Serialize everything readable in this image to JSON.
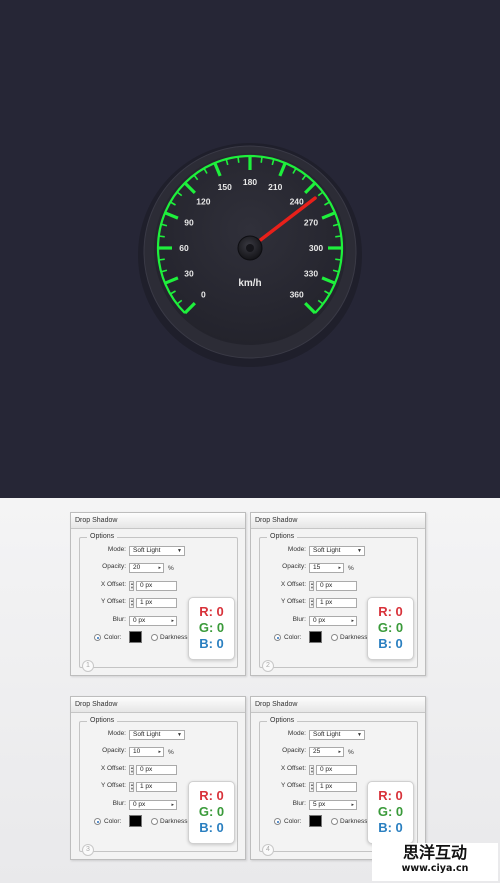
{
  "gauge": {
    "unit": "km/h",
    "min": 0,
    "max": 360,
    "scale_labels": [
      "0",
      "30",
      "60",
      "90",
      "120",
      "150",
      "180",
      "210",
      "240",
      "270",
      "300",
      "330",
      "360"
    ],
    "needle_value": 250,
    "colors": {
      "background": "#262636",
      "dial": "#2b2b33",
      "tick": "#1ef03c",
      "needle": "#e8201a",
      "label": "#e8e8e8"
    }
  },
  "panels": [
    {
      "title": "Drop Shadow",
      "legend": "Options",
      "mode_label": "Mode:",
      "mode": "Soft Light",
      "opacity_label": "Opacity:",
      "opacity": "20",
      "percent": "%",
      "xoffset_label": "X Offset:",
      "xoffset": "0 px",
      "yoffset_label": "Y Offset:",
      "yoffset": "1 px",
      "blur_label": "Blur:",
      "blur": "0 px",
      "color_label": "Color:",
      "darkness_label": "Darkness:",
      "number": "1"
    },
    {
      "title": "Drop Shadow",
      "legend": "Options",
      "mode_label": "Mode:",
      "mode": "Soft Light",
      "opacity_label": "Opacity:",
      "opacity": "15",
      "percent": "%",
      "xoffset_label": "X Offset:",
      "xoffset": "0 px",
      "yoffset_label": "Y Offset:",
      "yoffset": "1 px",
      "blur_label": "Blur:",
      "blur": "0 px",
      "color_label": "Color:",
      "darkness_label": "Darkness:",
      "number": "2"
    },
    {
      "title": "Drop Shadow",
      "legend": "Options",
      "mode_label": "Mode:",
      "mode": "Soft Light",
      "opacity_label": "Opacity:",
      "opacity": "10",
      "percent": "%",
      "xoffset_label": "X Offset:",
      "xoffset": "0 px",
      "yoffset_label": "Y Offset:",
      "yoffset": "1 px",
      "blur_label": "Blur:",
      "blur": "0 px",
      "color_label": "Color:",
      "darkness_label": "Darkness:",
      "number": "3"
    },
    {
      "title": "Drop Shadow",
      "legend": "Options",
      "mode_label": "Mode:",
      "mode": "Soft Light",
      "opacity_label": "Opacity:",
      "opacity": "25",
      "percent": "%",
      "xoffset_label": "X Offset:",
      "xoffset": "0 px",
      "yoffset_label": "Y Offset:",
      "yoffset": "1 px",
      "blur_label": "Blur:",
      "blur": "5 px",
      "color_label": "Color:",
      "darkness_label": "Darkness:",
      "number": "4"
    }
  ],
  "rgb_badge": {
    "r": "R: 0",
    "g": "G: 0",
    "b": "B: 0"
  },
  "watermark": {
    "name": "思洋互动",
    "url": "www.ciya.cn"
  }
}
